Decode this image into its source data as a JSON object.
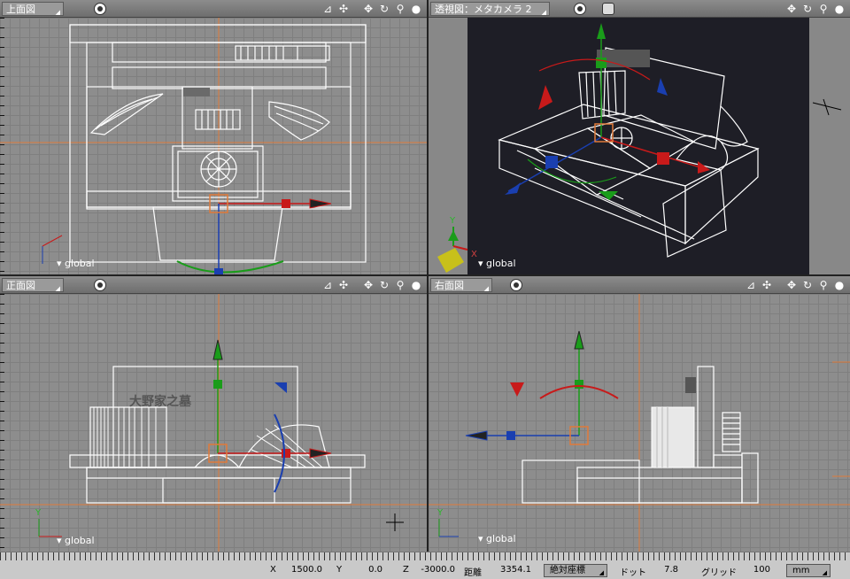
{
  "viewports": {
    "top": {
      "title": "上面図",
      "mode_label": "global"
    },
    "perspective": {
      "title": "透視図：メタカメラ 2",
      "mode_label": "global",
      "axis_labels": {
        "x": "X",
        "y": "Y"
      }
    },
    "front": {
      "title": "正面図",
      "mode_label": "global",
      "axis_label_y": "Y"
    },
    "right": {
      "title": "右面図",
      "mode_label": "global",
      "axis_label_y": "Y"
    }
  },
  "scene_text": {
    "plaque": "大野家之墓"
  },
  "toolbar_icons": [
    "axes-icon",
    "move-select-icon",
    "pan-icon",
    "rotate-icon",
    "zoom-icon",
    "shade-icon"
  ],
  "status": {
    "x_label": "X",
    "x_value": "1500.0",
    "y_label": "Y",
    "y_value": "0.0",
    "z_label": "Z",
    "z_value": "-3000.0",
    "distance_label": "距離",
    "distance_value": "3354.1",
    "coord_mode": "絶対座標",
    "dot_label": "ドット",
    "dot_value": "7.8",
    "grid_label": "グリッド",
    "grid_value": "100",
    "unit": "mm"
  },
  "colors": {
    "x_axis": "#c81a1a",
    "y_axis": "#1a9c1a",
    "z_axis": "#1a3fb0",
    "origin_line": "#e07a3a",
    "grid_bg": "#8d8d8d",
    "persp_bg": "#1e1e26"
  }
}
